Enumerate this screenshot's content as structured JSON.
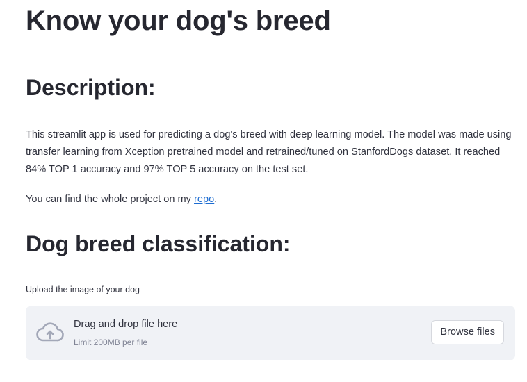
{
  "page": {
    "title": "Know your dog's breed"
  },
  "description": {
    "heading": "Description:",
    "text": "This streamlit app is used for predicting a dog's breed with deep learning model. The model was made using transfer learning from Xception pretrained model and retrained/tuned on StanfordDogs dataset. It reached 84% TOP 1 accuracy and 97% TOP 5 accuracy on the test set.",
    "repo_prefix": "You can find the whole project on my ",
    "repo_link": "repo",
    "repo_suffix": "."
  },
  "classification": {
    "heading": "Dog breed classification:",
    "upload_label": "Upload the image of your dog",
    "dropzone": {
      "title": "Drag and drop file here",
      "limit": "Limit 200MB per file",
      "browse_label": "Browse files",
      "icon": "cloud-upload-icon"
    }
  },
  "colors": {
    "text": "#31333f",
    "heading": "#262730",
    "link": "#1c6cd1",
    "dropzone_bg": "#f0f2f6",
    "muted": "#808495",
    "icon": "#a3a8b8"
  }
}
